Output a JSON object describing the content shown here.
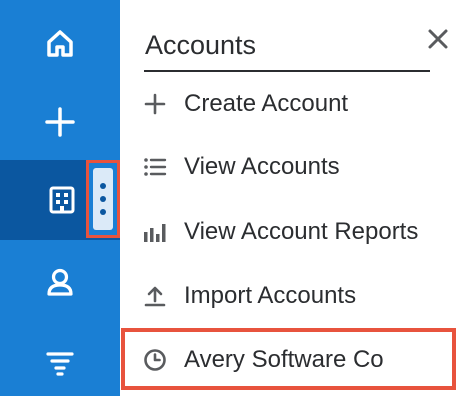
{
  "sidebar": {
    "items": [
      {
        "name": "home",
        "icon": "home-icon"
      },
      {
        "name": "quick-create",
        "icon": "plus-icon"
      },
      {
        "name": "accounts",
        "icon": "building-icon",
        "active": true
      },
      {
        "name": "contacts",
        "icon": "person-icon"
      },
      {
        "name": "filter",
        "icon": "filter-icon"
      }
    ],
    "colors": {
      "background": "#1a7fd4",
      "active": "#0b57a0",
      "icon": "#ffffff"
    }
  },
  "menu": {
    "title": "Accounts",
    "items": [
      {
        "label": "Create Account",
        "icon": "plus-icon"
      },
      {
        "label": "View Accounts",
        "icon": "list-icon"
      },
      {
        "label": "View Account Reports",
        "icon": "bar-chart-icon"
      },
      {
        "label": "Import Accounts",
        "icon": "upload-icon"
      },
      {
        "label": "Avery Software Co",
        "icon": "clock-icon"
      }
    ]
  },
  "annotation": {
    "highlight_color": "#e8533d"
  }
}
